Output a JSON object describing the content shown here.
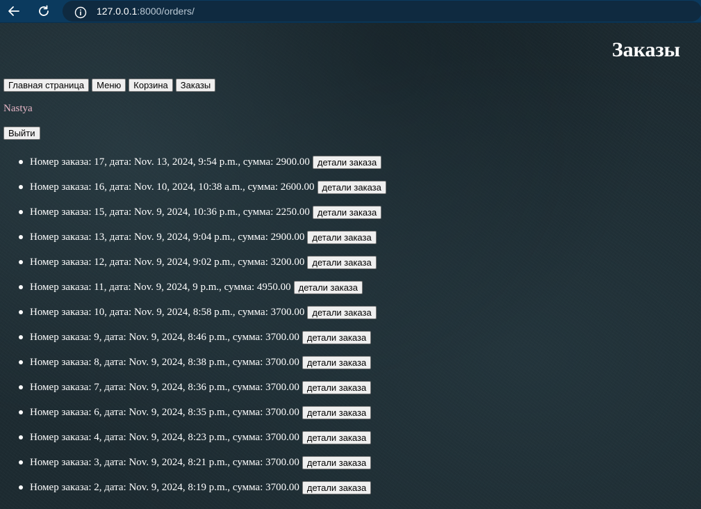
{
  "browser": {
    "url_host": "127.0.0.1",
    "url_path": ":8000/orders/"
  },
  "page": {
    "title": "Заказы",
    "nav": [
      "Главная страница",
      "Меню",
      "Корзина",
      "Заказы"
    ],
    "username": "Nastya",
    "logout_label": "Выйти",
    "details_label": "детали заказа",
    "orders": [
      {
        "text": "Номер заказа: 17, дата: Nov. 13, 2024, 9:54 p.m., сумма: 2900.00"
      },
      {
        "text": "Номер заказа: 16, дата: Nov. 10, 2024, 10:38 a.m., сумма: 2600.00"
      },
      {
        "text": "Номер заказа: 15, дата: Nov. 9, 2024, 10:36 p.m., сумма: 2250.00"
      },
      {
        "text": "Номер заказа: 13, дата: Nov. 9, 2024, 9:04 p.m., сумма: 2900.00"
      },
      {
        "text": "Номер заказа: 12, дата: Nov. 9, 2024, 9:02 p.m., сумма: 3200.00"
      },
      {
        "text": "Номер заказа: 11, дата: Nov. 9, 2024, 9 p.m., сумма: 4950.00"
      },
      {
        "text": "Номер заказа: 10, дата: Nov. 9, 2024, 8:58 p.m., сумма: 3700.00"
      },
      {
        "text": "Номер заказа: 9, дата: Nov. 9, 2024, 8:46 p.m., сумма: 3700.00"
      },
      {
        "text": "Номер заказа: 8, дата: Nov. 9, 2024, 8:38 p.m., сумма: 3700.00"
      },
      {
        "text": "Номер заказа: 7, дата: Nov. 9, 2024, 8:36 p.m., сумма: 3700.00"
      },
      {
        "text": "Номер заказа: 6, дата: Nov. 9, 2024, 8:35 p.m., сумма: 3700.00"
      },
      {
        "text": "Номер заказа: 4, дата: Nov. 9, 2024, 8:23 p.m., сумма: 3700.00"
      },
      {
        "text": "Номер заказа: 3, дата: Nov. 9, 2024, 8:21 p.m., сумма: 3700.00"
      },
      {
        "text": "Номер заказа: 2, дата: Nov. 9, 2024, 8:19 p.m., сумма: 3700.00"
      }
    ]
  }
}
